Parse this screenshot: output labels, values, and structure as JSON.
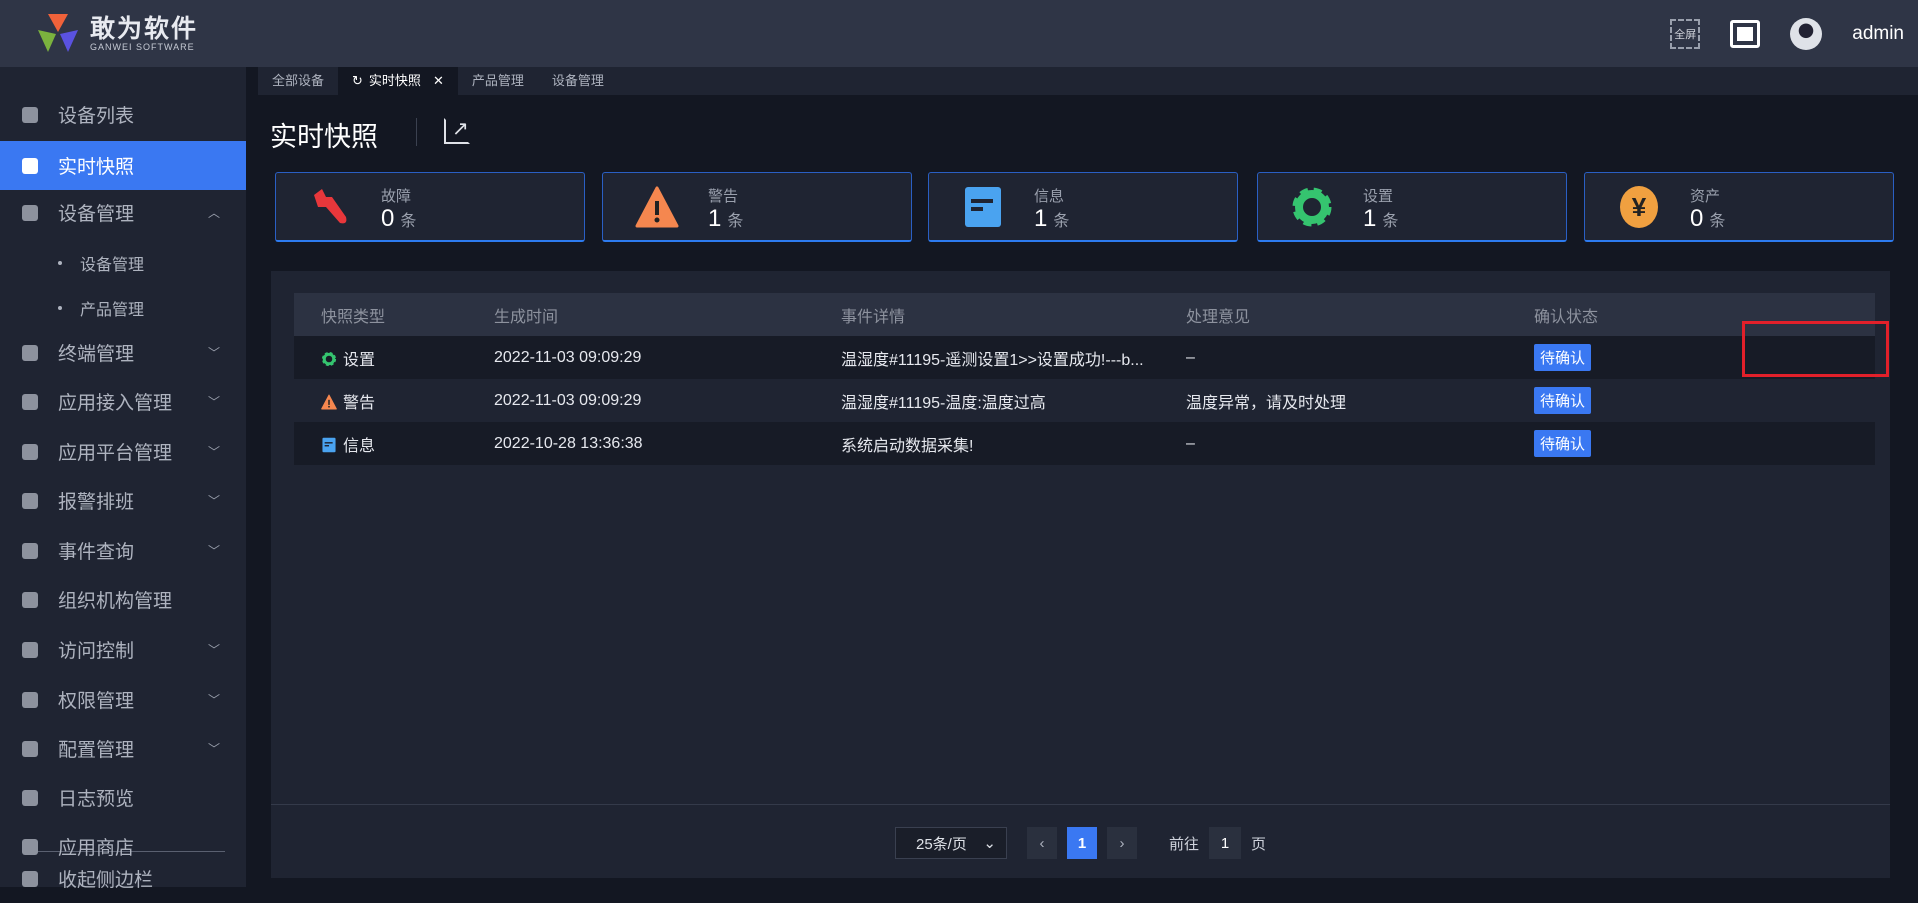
{
  "header": {
    "logo_cn": "敢为软件",
    "logo_en": "GANWEI SOFTWARE",
    "fullscreen_label": "全屏",
    "user": "admin"
  },
  "sidebar": {
    "items": [
      {
        "label": "设备列表",
        "icon": "monitor-icon"
      },
      {
        "label": "实时快照",
        "icon": "camera-icon",
        "active": true
      },
      {
        "label": "设备管理",
        "icon": "grid-icon",
        "arrow": "^"
      },
      {
        "label": "设备管理",
        "sub": true
      },
      {
        "label": "产品管理",
        "sub": true
      },
      {
        "label": "终端管理",
        "icon": "grid-icon",
        "arrow": "v"
      },
      {
        "label": "应用接入管理",
        "icon": "grid-icon",
        "arrow": "v"
      },
      {
        "label": "应用平台管理",
        "icon": "grid-icon",
        "arrow": "v"
      },
      {
        "label": "报警排班",
        "icon": "calendar-icon",
        "arrow": "v"
      },
      {
        "label": "事件查询",
        "icon": "search-doc-icon",
        "arrow": "v"
      },
      {
        "label": "组织机构管理",
        "icon": "gear-icon"
      },
      {
        "label": "访问控制",
        "icon": "doc-icon",
        "arrow": "v"
      },
      {
        "label": "权限管理",
        "icon": "shield-icon",
        "arrow": "v"
      },
      {
        "label": "配置管理",
        "icon": "bookmark-icon",
        "arrow": "v"
      },
      {
        "label": "日志预览",
        "icon": "doc-icon"
      },
      {
        "label": "应用商店",
        "icon": "store-icon"
      }
    ],
    "collapse_label": "收起侧边栏"
  },
  "tabs": [
    {
      "label": "全部设备"
    },
    {
      "label": "实时快照",
      "active": true
    },
    {
      "label": "产品管理"
    },
    {
      "label": "设备管理"
    }
  ],
  "page_title": "实时快照",
  "cards": [
    {
      "label": "故障",
      "value": "0",
      "unit": "条",
      "icon": "wrench-icon",
      "color": "#e8373b"
    },
    {
      "label": "警告",
      "value": "1",
      "unit": "条",
      "icon": "warning-icon",
      "color": "#f5874f"
    },
    {
      "label": "信息",
      "value": "1",
      "unit": "条",
      "icon": "info-icon",
      "color": "#4aa3f0"
    },
    {
      "label": "设置",
      "value": "1",
      "unit": "条",
      "icon": "gear-icon",
      "color": "#35c46f"
    },
    {
      "label": "资产",
      "value": "0",
      "unit": "条",
      "icon": "yen-icon",
      "color": "#f0a040"
    }
  ],
  "table": {
    "columns": [
      "快照类型",
      "生成时间",
      "事件详情",
      "处理意见",
      "确认状态"
    ],
    "rows": [
      {
        "type": "设置",
        "time": "2022-11-03 09:09:29",
        "detail": "温湿度#11195-遥测设置1>>设置成功!---b...",
        "opinion": "–",
        "status": "待确认"
      },
      {
        "type": "警告",
        "time": "2022-11-03 09:09:29",
        "detail": "温湿度#11195-温度:温度过高",
        "opinion": "温度异常，请及时处理",
        "status": "待确认"
      },
      {
        "type": "信息",
        "time": "2022-10-28 13:36:38",
        "detail": "系统启动数据采集!",
        "opinion": "–",
        "status": "待确认"
      }
    ]
  },
  "pagination": {
    "page_size": "25条/页",
    "current_page": "1",
    "goto_label": "前往",
    "goto_value": "1",
    "page_unit": "页"
  }
}
